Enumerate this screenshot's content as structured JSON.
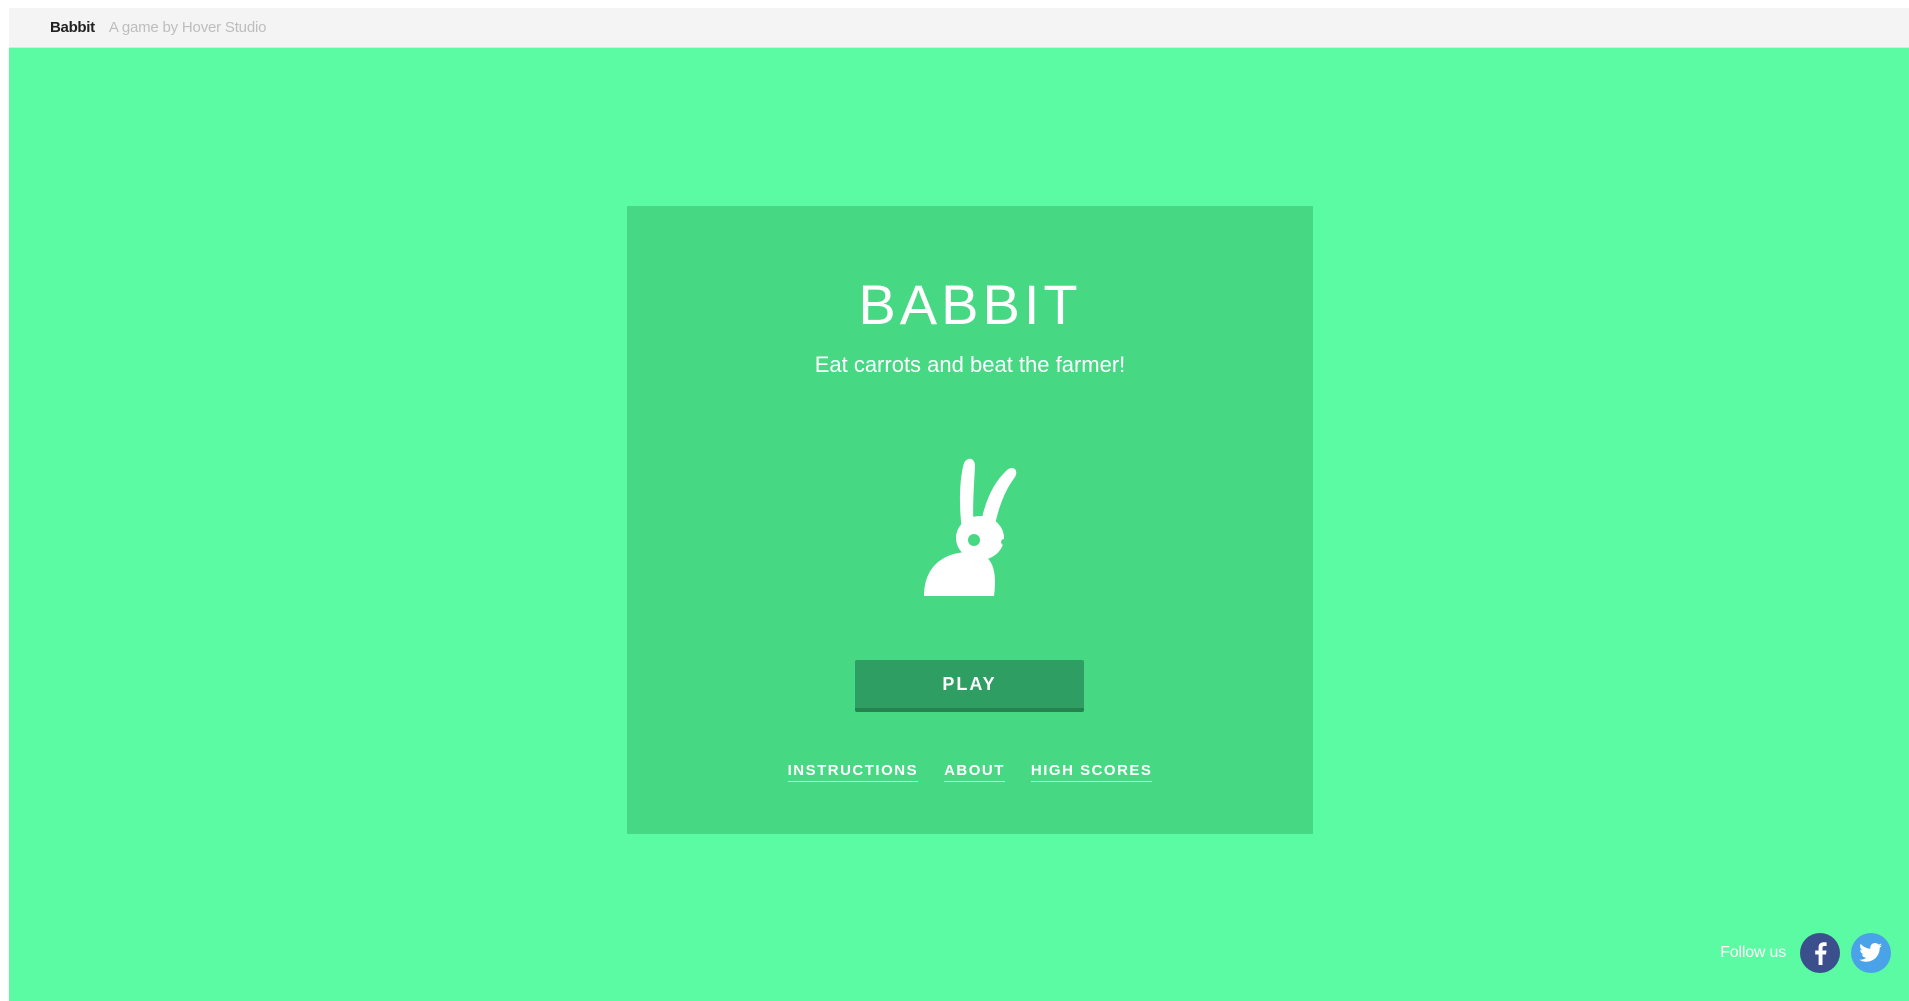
{
  "header": {
    "brand": "Babbit",
    "tagline": "A game by Hover Studio"
  },
  "menu": {
    "title": "BABBIT",
    "subtitle": "Eat carrots and beat the farmer!",
    "play_label": "PLAY",
    "links": [
      {
        "label": "INSTRUCTIONS"
      },
      {
        "label": "ABOUT"
      },
      {
        "label": "HIGH SCORES"
      }
    ]
  },
  "footer": {
    "follow_label": "Follow us",
    "social": [
      {
        "name": "facebook-icon",
        "color": "#3a4f8c"
      },
      {
        "name": "twitter-icon",
        "color": "#4aa3e8"
      }
    ]
  },
  "colors": {
    "background": "#5afba2",
    "card": "#47d884",
    "play_button": "#2f9e62"
  }
}
